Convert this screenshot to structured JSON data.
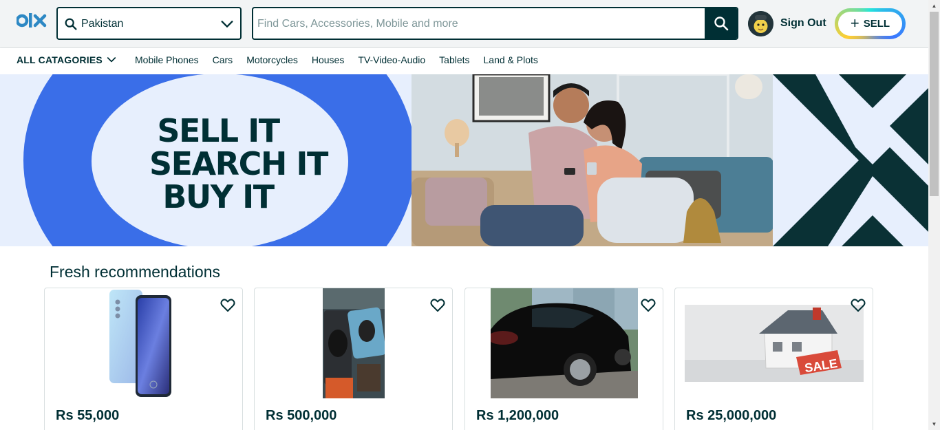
{
  "header": {
    "logo_icon": "olx-logo-icon",
    "location": {
      "value": "Pakistan",
      "icon": "search-icon",
      "dropdown_icon": "chevron-down-icon"
    },
    "search": {
      "placeholder": "Find Cars, Accessories, Mobile and more",
      "button_icon": "search-icon"
    },
    "avatar_icon": "user-avatar-icon",
    "sign_out_label": "Sign Out",
    "sell_button": {
      "plus": "+",
      "label": "SELL"
    }
  },
  "categories": {
    "all_label": "ALL CATAGORIES",
    "items": [
      "Mobile Phones",
      "Cars",
      "Motorcycles",
      "Houses",
      "TV-Video-Audio",
      "Tablets",
      "Land & Plots"
    ]
  },
  "hero": {
    "slogan": [
      "SELL IT",
      "SEARCH IT",
      "BUY IT"
    ],
    "colors": {
      "ring": "#3a6ee8",
      "background": "#e7effd",
      "dark_panel": "#0a3135"
    }
  },
  "recommendations": {
    "title": "Fresh recommendations",
    "items": [
      {
        "price": "Rs 55,000",
        "image": "smartphone-image",
        "favorite_icon": "heart-icon"
      },
      {
        "price": "Rs 500,000",
        "image": "computer-mouse-image",
        "favorite_icon": "heart-icon"
      },
      {
        "price": "Rs 1,200,000",
        "image": "black-sports-car-image",
        "favorite_icon": "heart-icon"
      },
      {
        "price": "Rs 25,000,000",
        "image": "house-for-sale-image",
        "favorite_icon": "heart-icon"
      }
    ]
  },
  "colors": {
    "primary": "#002f34",
    "header_bg": "#f2f4f5",
    "placeholder": "#7f9799"
  }
}
